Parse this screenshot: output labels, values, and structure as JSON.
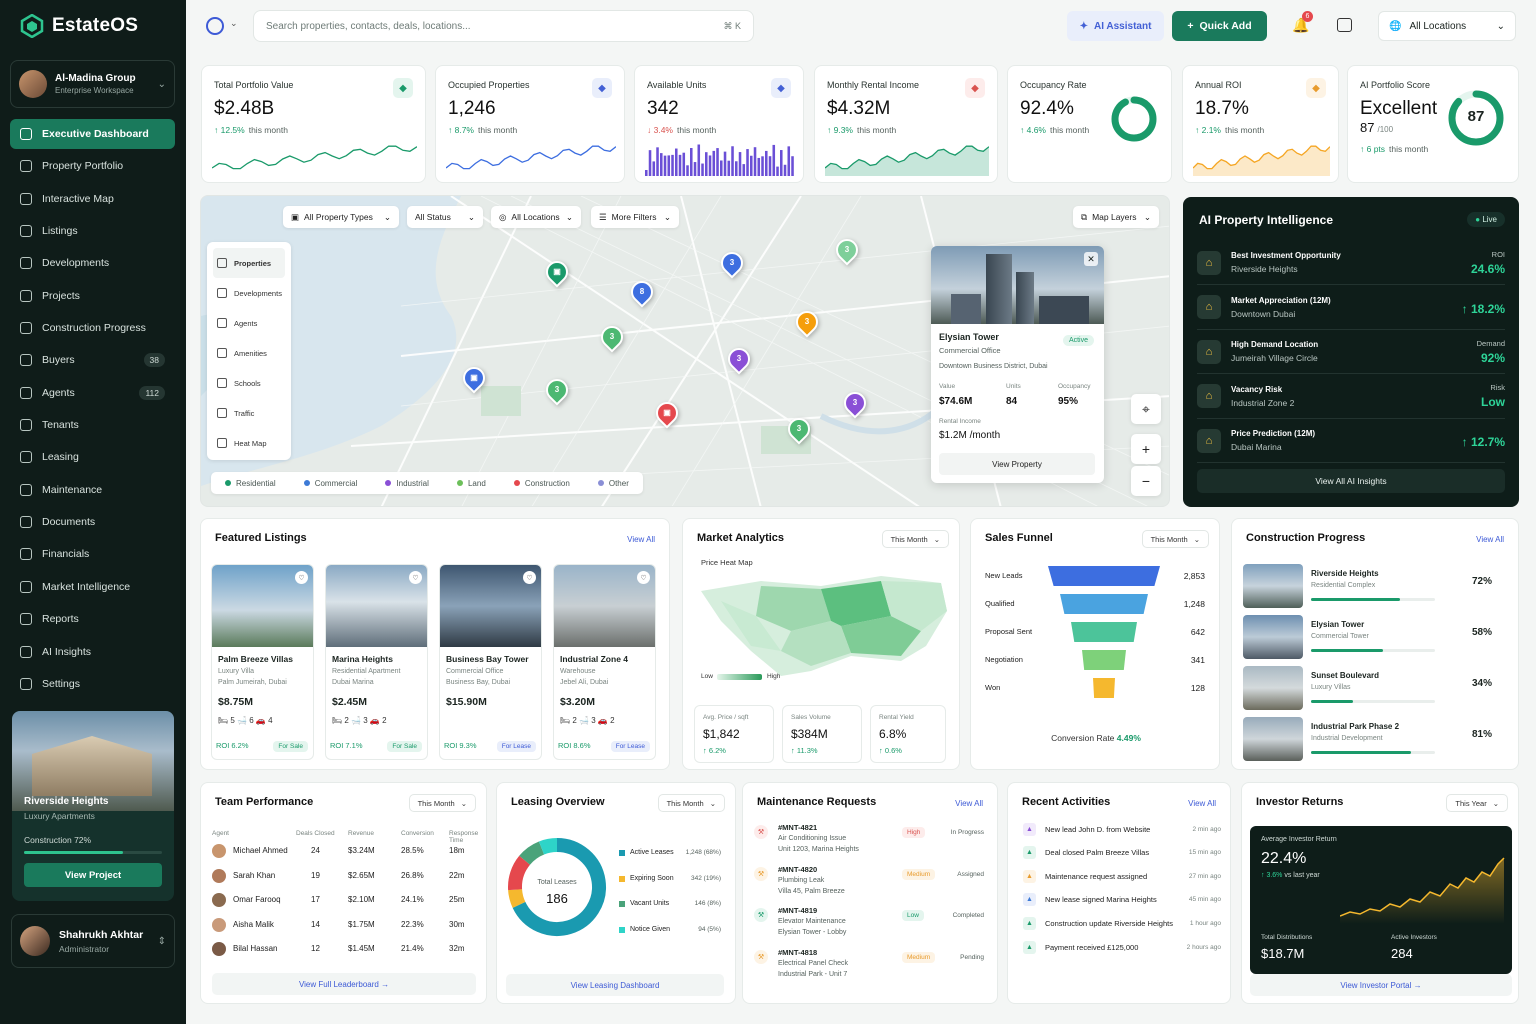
{
  "app": {
    "name": "EstateOS"
  },
  "org": {
    "name": "Al-Madina Group",
    "sub": "Enterprise Workspace",
    "initials": ""
  },
  "nav": [
    {
      "label": "Executive Dashboard",
      "active": true
    },
    {
      "label": "Property Portfolio"
    },
    {
      "label": "Interactive Map"
    },
    {
      "label": "Listings"
    },
    {
      "label": "Developments"
    },
    {
      "label": "Projects"
    },
    {
      "label": "Construction Progress"
    },
    {
      "label": "Buyers",
      "badge": "38"
    },
    {
      "label": "Agents",
      "badge": "112"
    },
    {
      "label": "Tenants"
    },
    {
      "label": "Leasing"
    },
    {
      "label": "Maintenance"
    },
    {
      "label": "Documents"
    },
    {
      "label": "Financials"
    },
    {
      "label": "Market Intelligence"
    },
    {
      "label": "Reports"
    },
    {
      "label": "AI Insights"
    },
    {
      "label": "Settings"
    }
  ],
  "promo": {
    "title": "Riverside Heights",
    "sub": "Luxury Apartments",
    "progress_label": "Construction 72%",
    "progress": 0.72,
    "button": "View Project"
  },
  "user": {
    "name": "Shahrukh Akhtar",
    "role": "Administrator"
  },
  "topbar": {
    "search_placeholder": "Search properties, contacts, deals, locations...",
    "shortcut": "⌘ K",
    "ai_assistant": "AI Assistant",
    "quick_add": "Quick Add",
    "notif_count": "6",
    "location": "All Locations"
  },
  "kpis": [
    {
      "label": "Total Portfolio Value",
      "value": "$2.48B",
      "delta": "↑ 12.5%",
      "period": "this month",
      "icon_color": "#1a9a6a",
      "icon_bg": "#e4f5ee",
      "icon": "user-icon"
    },
    {
      "label": "Occupied Properties",
      "value": "1,246",
      "delta": "↑ 8.7%",
      "period": "this month",
      "icon_color": "#4360d5",
      "icon_bg": "#e9eefb",
      "icon": "users-icon"
    },
    {
      "label": "Available Units",
      "value": "342",
      "delta": "↓ 3.4%",
      "period": "this month",
      "icon_color": "#4360d5",
      "icon_bg": "#e9eefb",
      "icon": "box-icon"
    },
    {
      "label": "Monthly Rental Income",
      "value": "$4.32M",
      "delta": "↑ 9.3%",
      "period": "this month",
      "icon_color": "#d9534f",
      "icon_bg": "#fdeceb",
      "icon": "pie-icon"
    },
    {
      "label": "Occupancy Rate",
      "value": "92.4%",
      "delta": "↑ 4.6%",
      "period": "this month",
      "ring": 0.924
    },
    {
      "label": "Annual ROI",
      "value": "18.7%",
      "delta": "↑ 2.1%",
      "period": "this month",
      "icon_color": "#e89b2d",
      "icon_bg": "#fdf3e4",
      "icon": "export-icon"
    },
    {
      "label": "AI Portfolio Score",
      "value": "Excellent",
      "score": "87",
      "score_max": "/100",
      "delta": "↑ 6 pts",
      "period": "this month",
      "ring_value": "87",
      "ring": 0.87
    }
  ],
  "map": {
    "filters": [
      "All Property Types",
      "All Status",
      "All Locations",
      "More Filters"
    ],
    "map_layers": "Map Layers",
    "layers": [
      "Properties",
      "Developments",
      "Agents",
      "Amenities",
      "Schools",
      "Traffic",
      "Heat Map"
    ],
    "legend": [
      {
        "label": "Residential",
        "color": "#1a9a6a"
      },
      {
        "label": "Commercial",
        "color": "#3d7ad6"
      },
      {
        "label": "Industrial",
        "color": "#8a4fd6"
      },
      {
        "label": "Land",
        "color": "#6cbf5a"
      },
      {
        "label": "Construction",
        "color": "#e5484d"
      },
      {
        "label": "Other",
        "color": "#8a8fd6"
      }
    ],
    "pins": [
      "3",
      "8",
      "3",
      "3",
      "3",
      "3",
      "3",
      "3",
      "3"
    ],
    "popup": {
      "title": "Elysian Tower",
      "type": "Commercial Office",
      "address": "Downtown Business District, Dubai",
      "status": "Active",
      "value_label": "Value",
      "value": "$74.6M",
      "units_label": "Units",
      "units": "84",
      "occ_label": "Occupancy",
      "occ": "95%",
      "rent_label": "Rental Income",
      "rent": "$1.2M /month",
      "button": "View Property"
    }
  },
  "ai": {
    "title": "AI Property Intelligence",
    "live": "Live",
    "rows": [
      {
        "title": "Best Investment Opportunity",
        "sub": "Riverside Heights",
        "label": "ROI",
        "value": "24.6%"
      },
      {
        "title": "Market Appreciation (12M)",
        "sub": "Downtown Dubai",
        "label": "",
        "value": "↑ 18.2%"
      },
      {
        "title": "High Demand Location",
        "sub": "Jumeirah Village Circle",
        "label": "Demand",
        "value": "92%"
      },
      {
        "title": "Vacancy Risk",
        "sub": "Industrial Zone 2",
        "label": "Risk",
        "value": "Low"
      },
      {
        "title": "Price Prediction (12M)",
        "sub": "Dubai Marina",
        "label": "",
        "value": "↑ 12.7%"
      }
    ],
    "button": "View All AI Insights"
  },
  "featured": {
    "title": "Featured Listings",
    "view_all": "View All",
    "items": [
      {
        "name": "Palm Breeze Villas",
        "type": "Luxury Villa",
        "loc": "Palm Jumeirah, Dubai",
        "price": "$8.75M",
        "feat": "🛏 5   🛁 6   🚗 4",
        "roi": "ROI 6.2%",
        "tag": "For Sale"
      },
      {
        "name": "Marina Heights",
        "type": "Residential Apartment",
        "loc": "Dubai Marina",
        "price": "$2.45M",
        "feat": "🛏 2   🛁 3   🚗 2",
        "roi": "ROI 7.1%",
        "tag": "For Sale"
      },
      {
        "name": "Business Bay Tower",
        "type": "Commercial Office",
        "loc": "Business Bay, Dubai",
        "price": "$15.90M",
        "feat": "",
        "roi": "ROI 9.3%",
        "tag": "For Lease"
      },
      {
        "name": "Industrial Zone 4",
        "type": "Warehouse",
        "loc": "Jebel Ali, Dubai",
        "price": "$3.20M",
        "feat": "🛏 2   🛁 3   🚗 2",
        "roi": "ROI 8.6%",
        "tag": "For Lease"
      }
    ]
  },
  "market": {
    "title": "Market Analytics",
    "period": "This Month",
    "map_label": "Price Heat Map",
    "low": "Low",
    "high": "High",
    "stats": [
      {
        "label": "Avg. Price / sqft",
        "value": "$1,842",
        "delta": "↑ 6.2%"
      },
      {
        "label": "Sales Volume",
        "value": "$384M",
        "delta": "↑ 11.3%"
      },
      {
        "label": "Rental Yield",
        "value": "6.8%",
        "delta": "↑ 0.6%"
      }
    ]
  },
  "funnel": {
    "title": "Sales Funnel",
    "period": "This Month",
    "stages": [
      {
        "label": "New Leads",
        "value": "2,853",
        "color": "#3d6ee0"
      },
      {
        "label": "Qualified",
        "value": "1,248",
        "color": "#4aa3e0"
      },
      {
        "label": "Proposal Sent",
        "value": "642",
        "color": "#4cc49a"
      },
      {
        "label": "Negotiation",
        "value": "341",
        "color": "#7ed17a"
      },
      {
        "label": "Won",
        "value": "128",
        "color": "#f5b82e"
      }
    ],
    "conversion_label": "Conversion Rate",
    "conversion": "4.49%"
  },
  "construction": {
    "title": "Construction Progress",
    "view_all": "View All",
    "items": [
      {
        "name": "Riverside Heights",
        "type": "Residential Complex",
        "pct": "72%",
        "val": 0.72
      },
      {
        "name": "Elysian Tower",
        "type": "Commercial Tower",
        "pct": "58%",
        "val": 0.58
      },
      {
        "name": "Sunset Boulevard",
        "type": "Luxury Villas",
        "pct": "34%",
        "val": 0.34
      },
      {
        "name": "Industrial Park Phase 2",
        "type": "Industrial Development",
        "pct": "81%",
        "val": 0.81
      }
    ]
  },
  "team": {
    "title": "Team Performance",
    "period": "This Month",
    "headers": [
      "Agent",
      "Deals Closed",
      "Revenue",
      "Conversion",
      "Response Time"
    ],
    "rows": [
      [
        "Michael Ahmed",
        "24",
        "$3.24M",
        "28.5%",
        "18m"
      ],
      [
        "Sarah Khan",
        "19",
        "$2.65M",
        "26.8%",
        "22m"
      ],
      [
        "Omar Farooq",
        "17",
        "$2.10M",
        "24.1%",
        "25m"
      ],
      [
        "Aisha Malik",
        "14",
        "$1.75M",
        "22.3%",
        "30m"
      ],
      [
        "Bilal Hassan",
        "12",
        "$1.45M",
        "21.4%",
        "32m"
      ]
    ],
    "button": "View Full Leaderboard →"
  },
  "leasing": {
    "title": "Leasing Overview",
    "period": "This Month",
    "center_label": "Total Leases",
    "center_value": "186",
    "items": [
      {
        "label": "Active Leases",
        "value": "1,248 (68%)",
        "color": "#1a9ab0"
      },
      {
        "label": "Expiring Soon",
        "value": "342 (19%)",
        "color": "#f5b82e"
      },
      {
        "label": "Vacant Units",
        "value": "146 (8%)",
        "color": "#4aa37a"
      },
      {
        "label": "Notice Given",
        "value": "94 (5%)",
        "color": "#2ed4c8"
      }
    ],
    "button": "View Leasing Dashboard"
  },
  "maintenance": {
    "title": "Maintenance Requests",
    "view_all": "View All",
    "items": [
      {
        "id": "#MNT-4821",
        "d1": "Air Conditioning Issue",
        "d2": "Unit 1203, Marina Heights",
        "pri": "High",
        "status": "In Progress",
        "pri_color": "#d9534f",
        "pri_bg": "#fdeceb"
      },
      {
        "id": "#MNT-4820",
        "d1": "Plumbing Leak",
        "d2": "Villa 45, Palm Breeze",
        "pri": "Medium",
        "status": "Assigned",
        "pri_color": "#e89b2d",
        "pri_bg": "#fdf3e4"
      },
      {
        "id": "#MNT-4819",
        "d1": "Elevator Maintenance",
        "d2": "Elysian Tower - Lobby",
        "pri": "Low",
        "status": "Completed",
        "pri_color": "#1a9a6a",
        "pri_bg": "#e4f5ee"
      },
      {
        "id": "#MNT-4818",
        "d1": "Electrical Panel Check",
        "d2": "Industrial Park - Unit 7",
        "pri": "Medium",
        "status": "Pending",
        "pri_color": "#e89b2d",
        "pri_bg": "#fdf3e4"
      }
    ]
  },
  "activities": {
    "title": "Recent Activities",
    "view_all": "View All",
    "items": [
      {
        "text": "New lead John D. from Website",
        "time": "2 min ago",
        "color": "#8a4fd6",
        "bg": "#f1eafb"
      },
      {
        "text": "Deal closed Palm Breeze Villas",
        "time": "15 min ago",
        "color": "#1a9a6a",
        "bg": "#e4f5ee"
      },
      {
        "text": "Maintenance request assigned",
        "time": "27 min ago",
        "color": "#e89b2d",
        "bg": "#fdf3e4"
      },
      {
        "text": "New lease signed Marina Heights",
        "time": "45 min ago",
        "color": "#3d7ad6",
        "bg": "#e9eefb"
      },
      {
        "text": "Construction update Riverside Heights",
        "time": "1 hour ago",
        "color": "#1a9a6a",
        "bg": "#e4f5ee"
      },
      {
        "text": "Payment received £125,000",
        "time": "2 hours ago",
        "color": "#1a9a6a",
        "bg": "#e4f5ee"
      }
    ]
  },
  "investor": {
    "title": "Investor Returns",
    "period": "This Year",
    "avg_label": "Average Investor Return",
    "avg": "22.4%",
    "delta": "↑ 3.6%",
    "delta_note": "vs last year",
    "dist_label": "Total Distributions",
    "dist": "$18.7M",
    "inv_label": "Active Investors",
    "inv": "284",
    "button": "View Investor Portal →"
  },
  "colors": {
    "accent": "#1a7a5c",
    "sidebar": "#0f1c19",
    "positive": "#1a9a6a"
  }
}
